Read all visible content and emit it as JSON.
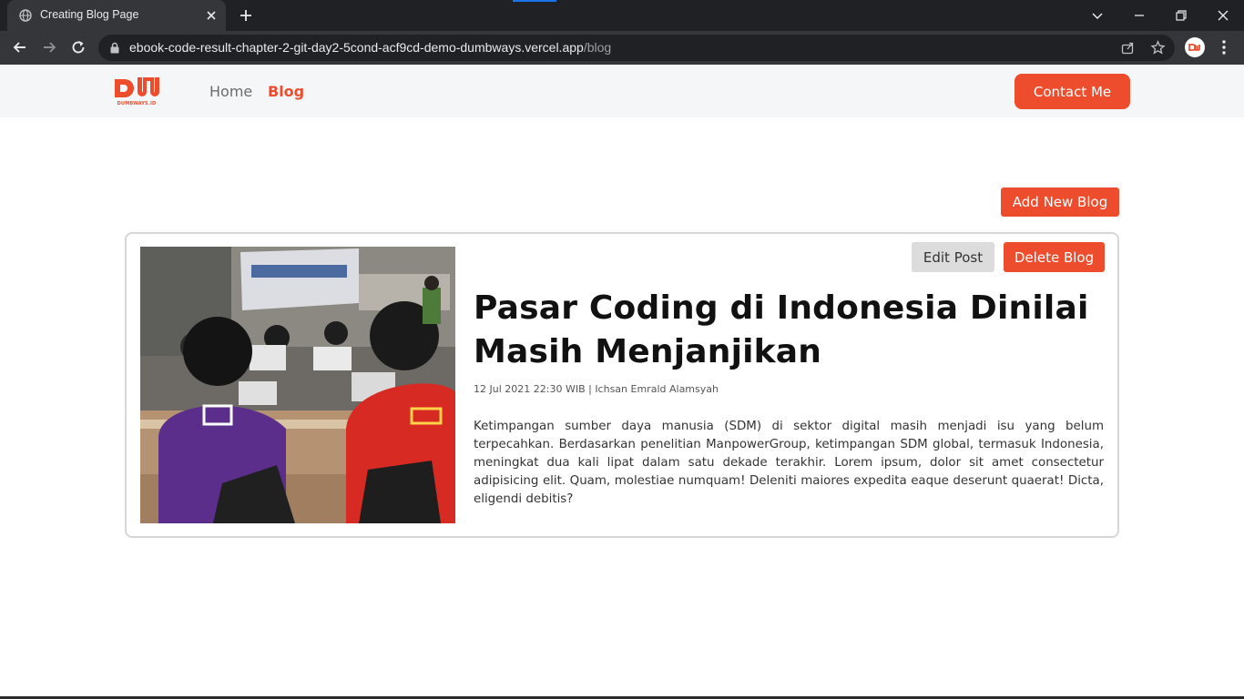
{
  "browser": {
    "tab_title": "Creating Blog Page",
    "url_host": "ebook-code-result-chapter-2-git-day2-5cond-acf9cd-demo-dumbways.vercel.app",
    "url_path": "/blog",
    "profile_initials": "DW"
  },
  "navbar": {
    "brand_letters": "DW",
    "brand_sub": "DUMBWAYS.ID",
    "links": [
      {
        "label": "Home",
        "active": false
      },
      {
        "label": "Blog",
        "active": true
      }
    ],
    "contact_label": "Contact Me"
  },
  "blog": {
    "add_label": "Add New Blog",
    "posts": [
      {
        "title": "Pasar Coding di Indonesia Dinilai Masih Menjanjikan",
        "meta": "12 Jul 2021 22:30 WIB | Ichsan Emrald Alamsyah",
        "body": "Ketimpangan sumber daya manusia (SDM) di sektor digital masih menjadi isu yang belum terpecahkan. Berdasarkan penelitian ManpowerGroup, ketimpangan SDM global, termasuk Indonesia, meningkat dua kali lipat dalam satu dekade terakhir. Lorem ipsum, dolor sit amet consectetur adipisicing elit. Quam, molestiae numquam! Deleniti maiores expedita eaque deserunt quaerat! Dicta, eligendi debitis?",
        "edit_label": "Edit Post",
        "delete_label": "Delete Blog",
        "image_caption_shirt": "DW"
      }
    ]
  },
  "colors": {
    "accent": "#ee4d2d",
    "navbar_bg": "#f5f6f8",
    "chrome_dark": "#202124",
    "chrome_toolbar": "#35363a"
  }
}
